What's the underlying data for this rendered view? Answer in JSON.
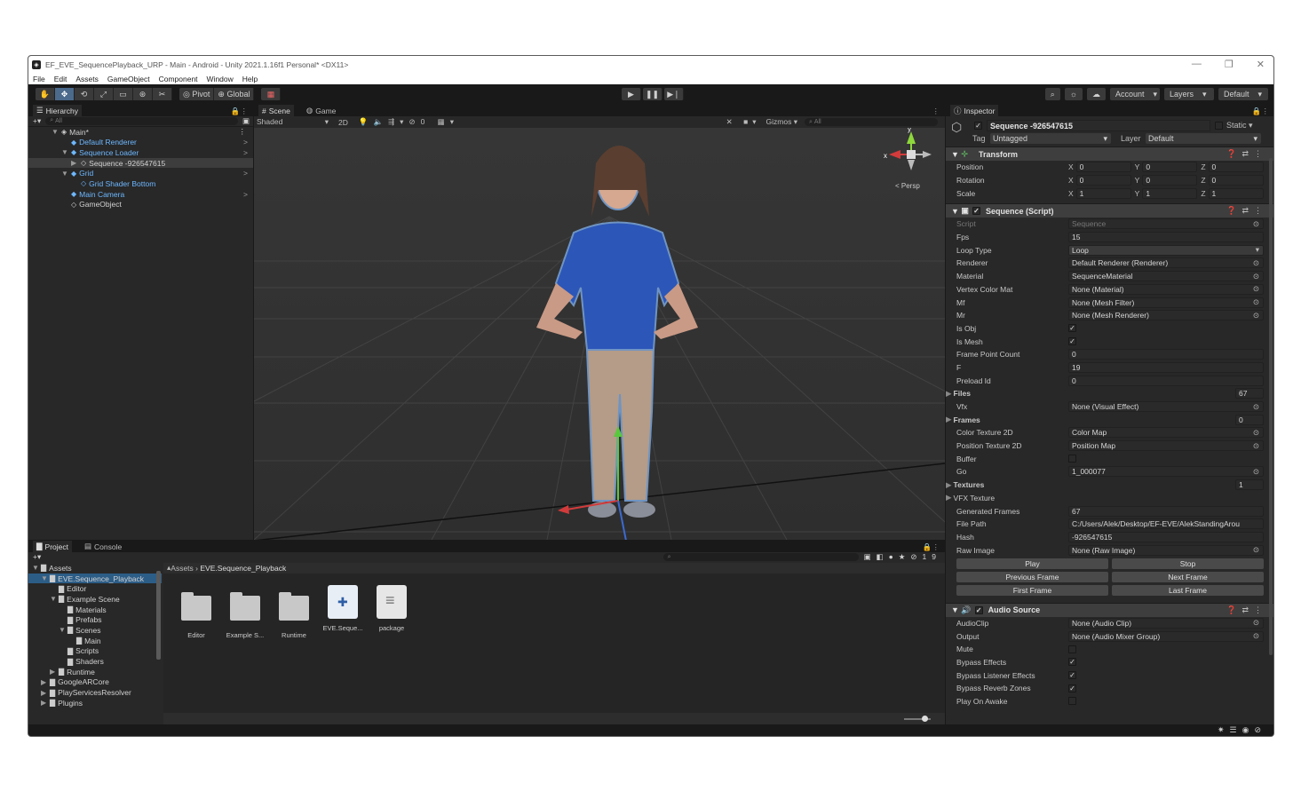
{
  "window": {
    "title": "EF_EVE_SequencePlayback_URP - Main - Android - Unity 2021.1.16f1 Personal* <DX11>",
    "minimize": "—",
    "restore": "❐",
    "close": "✕"
  },
  "menu": [
    "File",
    "Edit",
    "Assets",
    "GameObject",
    "Component",
    "Window",
    "Help"
  ],
  "toolbar": {
    "tools": [
      "✋",
      "✥",
      "⟲",
      "⤢",
      "▭",
      "⊛",
      "✂"
    ],
    "pivot": "Pivot",
    "global": "Global",
    "grid_icon": "▦",
    "play": "▶",
    "pause": "❚❚",
    "step": "▶❘",
    "search": "⌕",
    "collab": "☼",
    "cloud": "☁",
    "account": "Account",
    "layers": "Layers",
    "layout": "Default"
  },
  "hierarchy": {
    "tab": "Hierarchy",
    "add": "+▾",
    "search_placeholder": "All",
    "items": [
      {
        "label": "Main*",
        "indent": 0,
        "arrow": "▼",
        "icon": "◈",
        "color": "normal"
      },
      {
        "label": "Default Renderer",
        "indent": 1,
        "arrow": "",
        "icon": "◆",
        "color": "blue",
        "more": ">"
      },
      {
        "label": "Sequence Loader",
        "indent": 1,
        "arrow": "▼",
        "icon": "◆",
        "color": "blue",
        "more": ">"
      },
      {
        "label": "Sequence -926547615",
        "indent": 2,
        "arrow": "▶",
        "icon": "◇",
        "color": "normal",
        "more": ""
      },
      {
        "label": "Grid",
        "indent": 1,
        "arrow": "▼",
        "icon": "◆",
        "color": "blue",
        "more": ">"
      },
      {
        "label": "Grid Shader Bottom",
        "indent": 2,
        "arrow": "",
        "icon": "◇",
        "color": "blue",
        "more": ""
      },
      {
        "label": "Main Camera",
        "indent": 1,
        "arrow": "",
        "icon": "◆",
        "color": "blue",
        "more": ">"
      },
      {
        "label": "GameObject",
        "indent": 1,
        "arrow": "",
        "icon": "◇",
        "color": "normal",
        "more": ""
      }
    ]
  },
  "scene": {
    "tab_scene": "Scene",
    "tab_game": "Game",
    "shading": "Shaded",
    "mode2d": "2D",
    "gizmos": "Gizmos",
    "search_placeholder": "All",
    "persp": "< Persp",
    "axis_x": "x",
    "axis_y": "y",
    "hidden_count": "0"
  },
  "project": {
    "tab_project": "Project",
    "tab_console": "Console",
    "add": "+▾",
    "breadcrumb": [
      "Assets",
      "EVE.Sequence_Playback"
    ],
    "hidden_count": "19",
    "tree": [
      {
        "label": "Assets",
        "indent": 0,
        "arrow": "▼"
      },
      {
        "label": "EVE.Sequence_Playback",
        "indent": 1,
        "arrow": "▼",
        "selected": true
      },
      {
        "label": "Editor",
        "indent": 2,
        "arrow": ""
      },
      {
        "label": "Example Scene",
        "indent": 2,
        "arrow": "▼"
      },
      {
        "label": "Materials",
        "indent": 3,
        "arrow": ""
      },
      {
        "label": "Prefabs",
        "indent": 3,
        "arrow": ""
      },
      {
        "label": "Scenes",
        "indent": 3,
        "arrow": "▼"
      },
      {
        "label": "Main",
        "indent": 4,
        "arrow": ""
      },
      {
        "label": "Scripts",
        "indent": 3,
        "arrow": ""
      },
      {
        "label": "Shaders",
        "indent": 3,
        "arrow": ""
      },
      {
        "label": "Runtime",
        "indent": 2,
        "arrow": "▶"
      },
      {
        "label": "GoogleARCore",
        "indent": 1,
        "arrow": "▶"
      },
      {
        "label": "PlayServicesResolver",
        "indent": 1,
        "arrow": "▶"
      },
      {
        "label": "Plugins",
        "indent": 1,
        "arrow": "▶"
      }
    ],
    "assets": [
      {
        "label": "Editor",
        "type": "folder"
      },
      {
        "label": "Example S...",
        "type": "folder"
      },
      {
        "label": "Runtime",
        "type": "folder"
      },
      {
        "label": "EVE.Seque...",
        "type": "asm"
      },
      {
        "label": "package",
        "type": "doc"
      }
    ]
  },
  "inspector": {
    "tab": "Inspector",
    "name": "Sequence -926547615",
    "static": "Static",
    "tag_label": "Tag",
    "tag": "Untagged",
    "layer_label": "Layer",
    "layer": "Default",
    "transform": {
      "title": "Transform",
      "position": [
        "0",
        "0",
        "0"
      ],
      "rotation": [
        "0",
        "0",
        "0"
      ],
      "scale": [
        "1",
        "1",
        "1"
      ],
      "labels": [
        "Position",
        "Rotation",
        "Scale"
      ]
    },
    "script": {
      "title": "Sequence (Script)",
      "props": [
        {
          "label": "Script",
          "value": "Sequence",
          "kind": "obj",
          "dim": true
        },
        {
          "label": "Fps",
          "value": "15",
          "kind": "field"
        },
        {
          "label": "Loop Type",
          "value": "Loop",
          "kind": "dropdown"
        },
        {
          "label": "Renderer",
          "value": "Default Renderer (Renderer)",
          "kind": "obj"
        },
        {
          "label": "Material",
          "value": "SequenceMaterial",
          "kind": "obj"
        },
        {
          "label": "Vertex Color Mat",
          "value": "None (Material)",
          "kind": "obj"
        },
        {
          "label": "Mf",
          "value": "None (Mesh Filter)",
          "kind": "obj"
        },
        {
          "label": "Mr",
          "value": "None (Mesh Renderer)",
          "kind": "obj"
        },
        {
          "label": "Is Obj",
          "value": "✓",
          "kind": "check"
        },
        {
          "label": "Is Mesh",
          "value": "✓",
          "kind": "check"
        },
        {
          "label": "Frame Point Count",
          "value": "0",
          "kind": "field"
        },
        {
          "label": "F",
          "value": "19",
          "kind": "field"
        },
        {
          "label": "Preload Id",
          "value": "0",
          "kind": "field"
        },
        {
          "label": "Files",
          "value": "67",
          "kind": "foldout"
        },
        {
          "label": "Vfx",
          "value": "None (Visual Effect)",
          "kind": "obj"
        },
        {
          "label": "Frames",
          "value": "0",
          "kind": "foldout"
        },
        {
          "label": "Color Texture 2D",
          "value": "Color Map",
          "kind": "obj"
        },
        {
          "label": "Position Texture 2D",
          "value": "Position Map",
          "kind": "obj"
        },
        {
          "label": "Buffer",
          "value": "",
          "kind": "check"
        },
        {
          "label": "Go",
          "value": "1_000077",
          "kind": "obj"
        },
        {
          "label": "Textures",
          "value": "1",
          "kind": "foldout"
        },
        {
          "label": "VFX Texture",
          "value": "",
          "kind": "foldout2"
        },
        {
          "label": "Generated Frames",
          "value": "67",
          "kind": "field"
        },
        {
          "label": "File Path",
          "value": "C:/Users/Alek/Desktop/EF-EVE/AlekStandingArou",
          "kind": "field"
        },
        {
          "label": "Hash",
          "value": "-926547615",
          "kind": "field"
        },
        {
          "label": "Raw Image",
          "value": "None (Raw Image)",
          "kind": "obj"
        }
      ],
      "buttons": [
        [
          "Play",
          "Stop"
        ],
        [
          "Previous Frame",
          "Next Frame"
        ],
        [
          "First Frame",
          "Last Frame"
        ]
      ]
    },
    "audio": {
      "title": "Audio Source",
      "props": [
        {
          "label": "AudioClip",
          "value": "None (Audio Clip)",
          "kind": "obj"
        },
        {
          "label": "Output",
          "value": "None (Audio Mixer Group)",
          "kind": "obj"
        },
        {
          "label": "Mute",
          "value": "",
          "kind": "check"
        },
        {
          "label": "Bypass Effects",
          "value": "✓",
          "kind": "check"
        },
        {
          "label": "Bypass Listener Effects",
          "value": "✓",
          "kind": "check"
        },
        {
          "label": "Bypass Reverb Zones",
          "value": "✓",
          "kind": "check"
        },
        {
          "label": "Play On Awake",
          "value": "",
          "kind": "check"
        }
      ]
    }
  },
  "colors": {
    "accent": "#4b6a8c",
    "selection": "#2c5d87",
    "link": "#6db7ff"
  }
}
